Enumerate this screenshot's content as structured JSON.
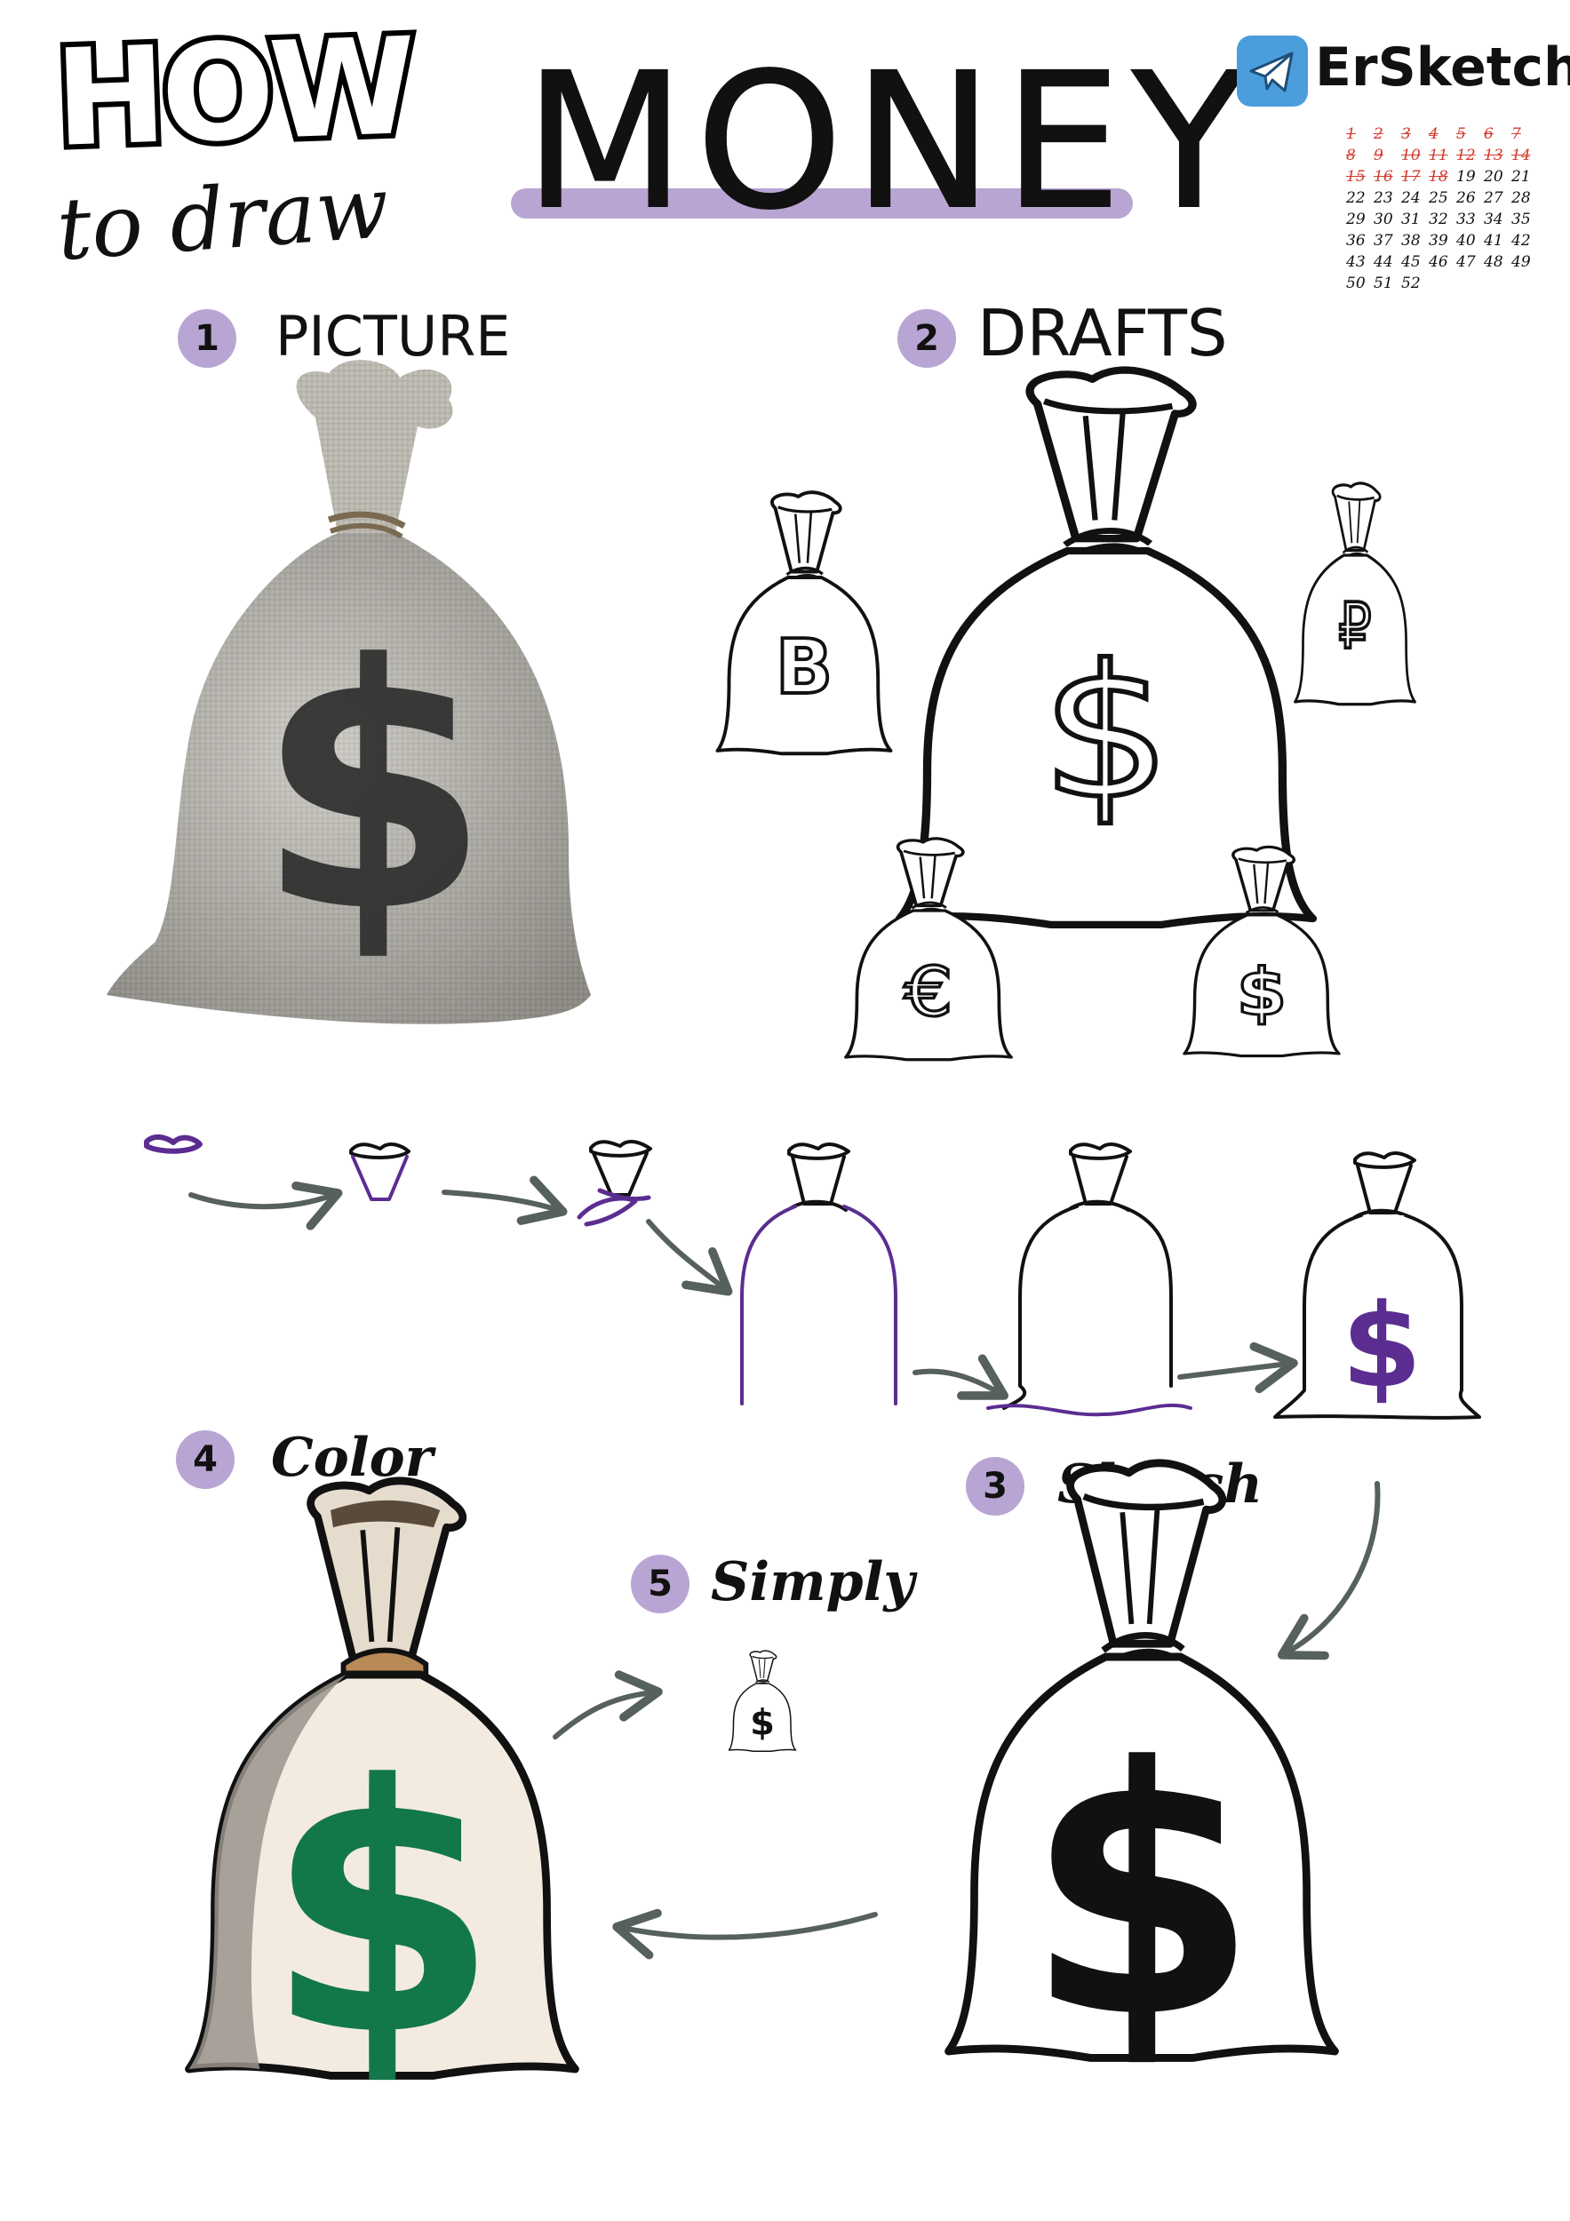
{
  "header": {
    "how": "HOW",
    "to_draw": "to draw",
    "title": "MONEY",
    "brand": "ErSketch"
  },
  "calendar": {
    "days": [
      "1",
      "2",
      "3",
      "4",
      "5",
      "6",
      "7",
      "8",
      "9",
      "10",
      "11",
      "12",
      "13",
      "14",
      "15",
      "16",
      "17",
      "18",
      "19",
      "20",
      "21",
      "22",
      "23",
      "24",
      "25",
      "26",
      "27",
      "28",
      "29",
      "30",
      "31",
      "32",
      "33",
      "34",
      "35",
      "36",
      "37",
      "38",
      "39",
      "40",
      "41",
      "42",
      "43",
      "44",
      "45",
      "46",
      "47",
      "48",
      "49",
      "50",
      "51",
      "52"
    ],
    "completed_through": 18
  },
  "steps": {
    "s1": {
      "number": "1",
      "label": "PICTURE"
    },
    "s2": {
      "number": "2",
      "label": "DRAFTS"
    },
    "s3": {
      "number": "3",
      "label": "Sketch"
    },
    "s4": {
      "number": "4",
      "label": "Color"
    },
    "s5": {
      "number": "5",
      "label": "Simply"
    }
  },
  "symbols": {
    "dollar": "$",
    "bitcoin": "B",
    "ruble": "₽",
    "euro": "€"
  },
  "colors": {
    "accent_purple": "#b9a5d3",
    "draw_purple": "#5b2d91",
    "money_green": "#12784a",
    "bag_cream": "#f3ebe0",
    "burlap_gray": "#bdbab2",
    "arrow_gray": "#56605c",
    "brand_blue": "#4b9edb"
  }
}
